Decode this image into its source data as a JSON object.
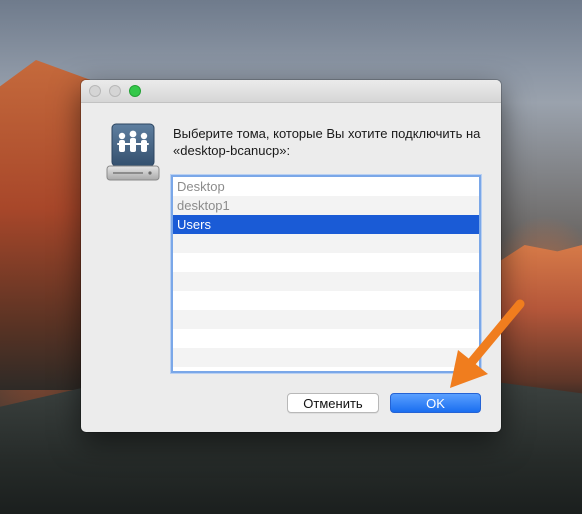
{
  "dialog": {
    "prompt": "Выберите тома, которые Вы хотите подключить на «desktop-bcanucp»:",
    "icon": "file-server-icon",
    "volumes": [
      {
        "label": "Desktop",
        "selected": false
      },
      {
        "label": "desktop1",
        "selected": false
      },
      {
        "label": "Users",
        "selected": true
      },
      {
        "label": "",
        "selected": false
      },
      {
        "label": "",
        "selected": false
      },
      {
        "label": "",
        "selected": false
      },
      {
        "label": "",
        "selected": false
      },
      {
        "label": "",
        "selected": false
      },
      {
        "label": "",
        "selected": false
      },
      {
        "label": "",
        "selected": false
      }
    ],
    "cancel_label": "Отменить",
    "ok_label": "OK"
  },
  "colors": {
    "selection": "#1a5bd6",
    "default_button": "#1a6ef0",
    "arrow": "#f07d1e"
  }
}
